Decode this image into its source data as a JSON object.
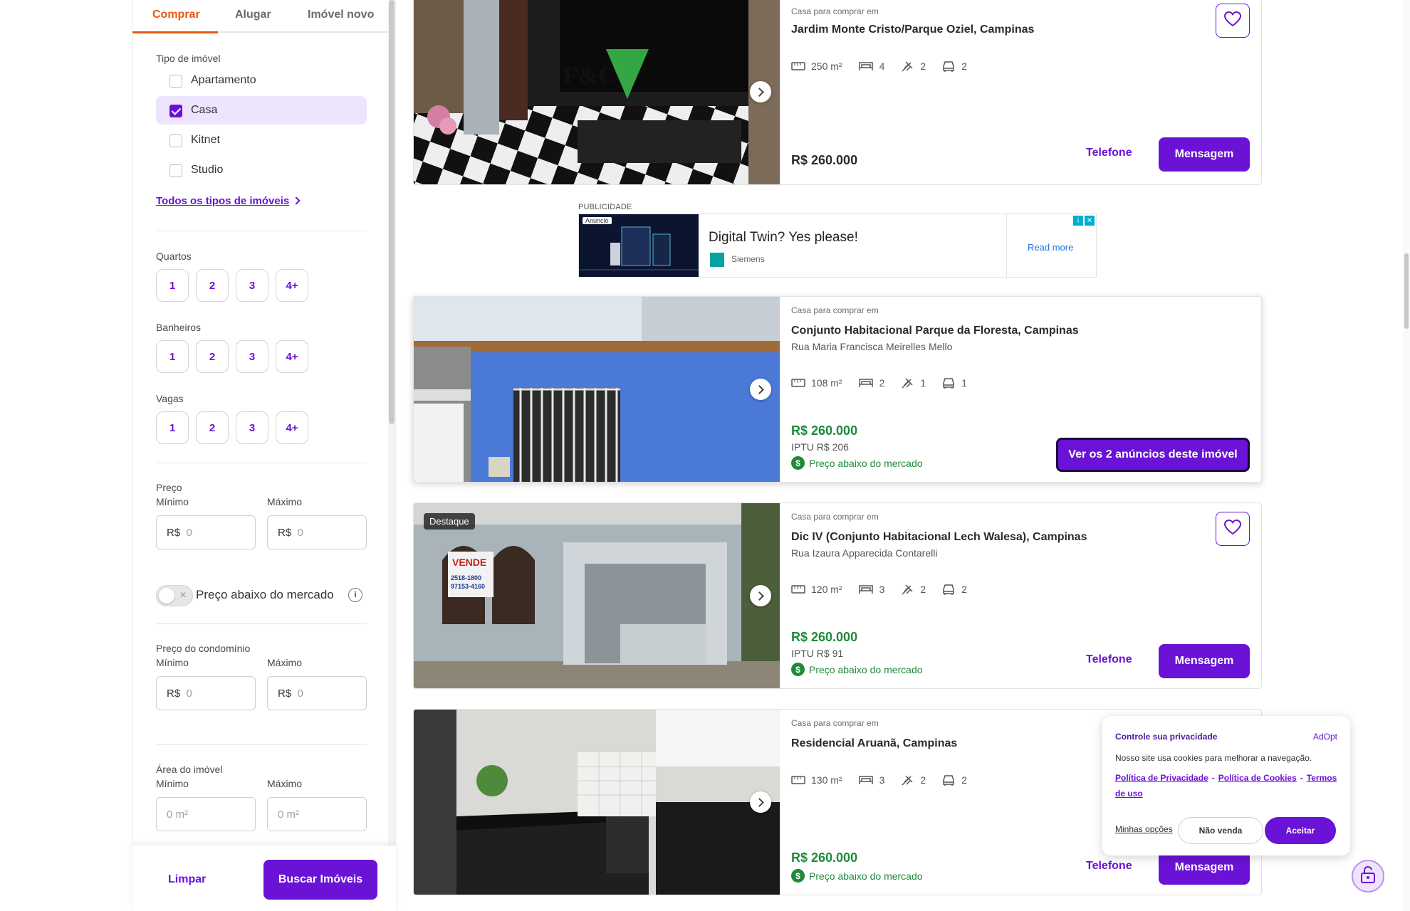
{
  "tabs": [
    "Comprar",
    "Alugar",
    "Imóvel novo"
  ],
  "filters": {
    "tipo_label": "Tipo de imóvel",
    "tipos": [
      {
        "label": "Apartamento",
        "checked": false
      },
      {
        "label": "Casa",
        "checked": true
      },
      {
        "label": "Kitnet",
        "checked": false
      },
      {
        "label": "Studio",
        "checked": false
      }
    ],
    "todos_tipos": "Todos os tipos de imóveis",
    "quartos_label": "Quartos",
    "banheiros_label": "Banheiros",
    "vagas_label": "Vagas",
    "counts": [
      "1",
      "2",
      "3",
      "4+"
    ],
    "preco_label": "Preço",
    "minimo": "Mínimo",
    "maximo": "Máximo",
    "currency": "R$",
    "placeholder_zero": "0",
    "abaixo_mercado": "Preço abaixo do mercado",
    "condominio_label": "Preço do condomínio",
    "area_label": "Área do imóvel",
    "area_placeholder": "0 m²",
    "limpar": "Limpar",
    "buscar": "Buscar Imóveis"
  },
  "listings": [
    {
      "kicker": "Casa para comprar em",
      "title": "Jardim Monte Cristo/Parque Oziel, Campinas",
      "street": "",
      "area": "250 m²",
      "quartos": "4",
      "banheiros": "2",
      "vagas": "2",
      "price": "R$ 260.000",
      "telefone": "Telefone",
      "mensagem": "Mensagem"
    },
    {
      "kicker": "Casa para comprar em",
      "title": "Conjunto Habitacional Parque da Floresta, Campinas",
      "street": "Rua Maria Francisca Meirelles Mello",
      "area": "108 m²",
      "quartos": "2",
      "banheiros": "1",
      "vagas": "1",
      "price": "R$ 260.000",
      "iptu": "IPTU R$ 206",
      "below": "Preço abaixo do mercado",
      "ver": "Ver os 2 anúncios deste imóvel"
    },
    {
      "kicker": "Casa para comprar em",
      "title": "Dic IV (Conjunto Habitacional Lech Walesa), Campinas",
      "street": "Rua Izaura Apparecida Contarelli",
      "area": "120 m²",
      "quartos": "3",
      "banheiros": "2",
      "vagas": "2",
      "price": "R$ 260.000",
      "iptu": "IPTU R$ 91",
      "below": "Preço abaixo do mercado",
      "destaque": "Destaque",
      "telefone": "Telefone",
      "mensagem": "Mensagem"
    },
    {
      "kicker": "Casa para comprar em",
      "title": "Residencial Aruanã, Campinas",
      "street": "",
      "area": "130 m²",
      "quartos": "3",
      "banheiros": "2",
      "vagas": "2",
      "price": "R$ 260.000",
      "below": "Preço abaixo do mercado",
      "telefone": "Telefone",
      "mensagem": "Mensagem"
    }
  ],
  "ad": {
    "label": "PUBLICIDADE",
    "badge": "Anúncio",
    "headline": "Digital Twin? Yes please!",
    "brand": "Siemens",
    "cta": "Read more"
  },
  "cookie": {
    "title": "Controle sua privacidade",
    "brand": "AdOpt",
    "text": "Nosso site usa cookies para melhorar a navegação.",
    "link1": "Política de Privacidade",
    "link2": "Política de Cookies",
    "link3": "Termos de uso",
    "opcoes": "Minhas opções",
    "nao_venda": "Não venda",
    "aceitar": "Aceitar"
  },
  "colors": {
    "brand": "#6a12d6",
    "accent_tab": "#e8580e",
    "price_green": "#1f8a3a"
  }
}
